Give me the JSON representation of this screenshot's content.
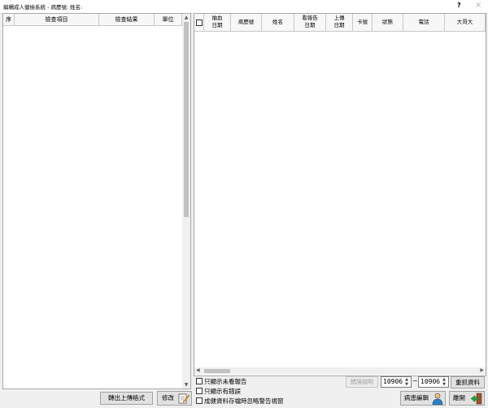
{
  "window": {
    "title": "編輯成人健檢系統 - 病歷號:",
    "name_label": "姓名:",
    "help": "?",
    "close": "×"
  },
  "left_table": {
    "columns": [
      "序",
      "檢查項目",
      "檢查結果",
      "單位"
    ]
  },
  "right_table": {
    "columns": [
      {
        "l1": "抽血",
        "l2": "日期"
      },
      {
        "l1": "病歷號",
        "l2": ""
      },
      {
        "l1": "姓名",
        "l2": ""
      },
      {
        "l1": "看報告",
        "l2": "日期"
      },
      {
        "l1": "上傳",
        "l2": "日期"
      },
      {
        "l1": "卡號",
        "l2": ""
      },
      {
        "l1": "狀態",
        "l2": ""
      },
      {
        "l1": "電話",
        "l2": ""
      },
      {
        "l1": "大哥大",
        "l2": ""
      }
    ]
  },
  "buttons": {
    "export": "轉出上傳格式",
    "modify": "修改",
    "error_desc": "錯誤說明",
    "reload": "重抓資料",
    "patient_edit": "病患編輯",
    "exit": "離開"
  },
  "checkboxes": {
    "unread_report": "只顯示未看報告",
    "has_error": "只顯示有錯誤",
    "ignore_warning": "成健資料存檔時忽略警告視窗"
  },
  "date_range": {
    "from": "10906",
    "sep": "~",
    "to": "10906"
  }
}
